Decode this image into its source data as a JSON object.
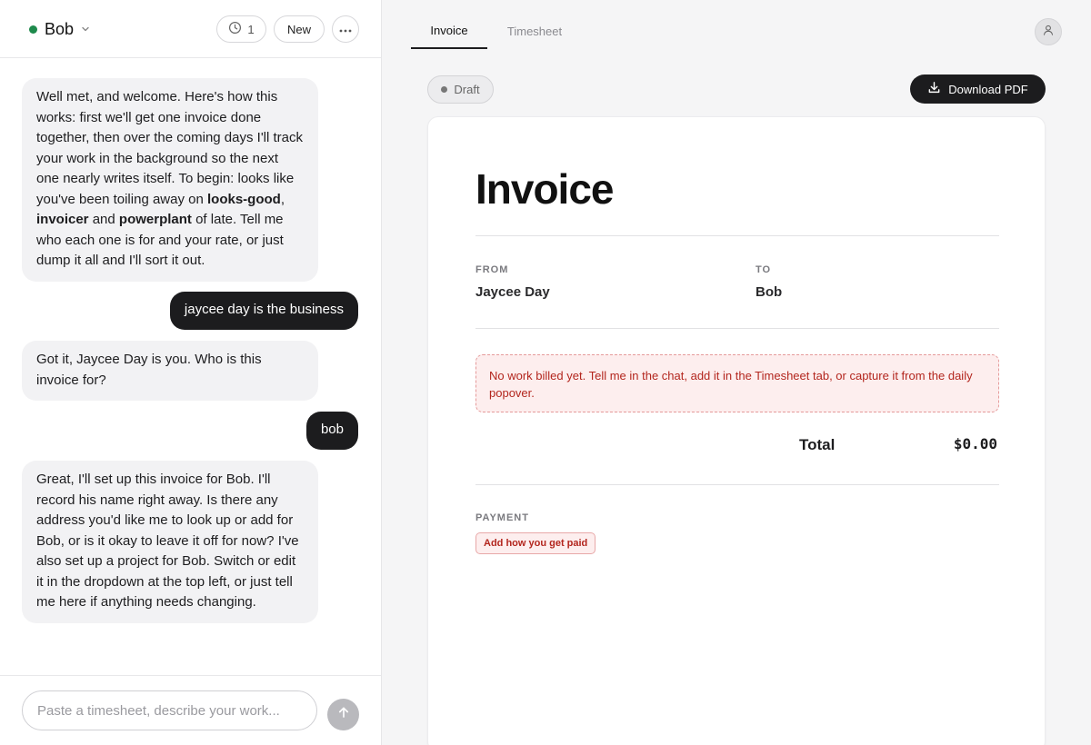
{
  "header": {
    "project_name": "Bob",
    "history_count": "1",
    "new_label": "New",
    "status_color": "#1e8a4c"
  },
  "chat": {
    "messages": [
      {
        "role": "assistant",
        "parts": [
          {
            "text": "Well met, and welcome. Here's how this works: first we'll get one invoice done together, then over the coming days I'll track your work in the background so the next one nearly writes itself. To begin: looks like you've been toiling away on "
          },
          {
            "text": "looks-good",
            "bold": true
          },
          {
            "text": ", "
          },
          {
            "text": "invoicer",
            "bold": true
          },
          {
            "text": " and "
          },
          {
            "text": "powerplant",
            "bold": true
          },
          {
            "text": " of late. Tell me who each one is for and your rate, or just dump it all and I'll sort it out."
          }
        ]
      },
      {
        "role": "user",
        "text": "jaycee day is the business"
      },
      {
        "role": "assistant",
        "text": "Got it, Jaycee Day is you. Who is this invoice for?"
      },
      {
        "role": "user",
        "text": "bob"
      },
      {
        "role": "assistant",
        "text": "Great, I'll set up this invoice for Bob. I'll record his name right away. Is there any address you'd like me to look up or add for Bob, or is it okay to leave it off for now? I've also set up a project for Bob. Switch or edit it in the dropdown at the top left, or just tell me here if anything needs changing."
      }
    ],
    "input_placeholder": "Paste a timesheet, describe your work..."
  },
  "tabs": {
    "invoice": "Invoice",
    "timesheet": "Timesheet",
    "active": "invoice"
  },
  "toolbar": {
    "status": "Draft",
    "download_label": "Download PDF"
  },
  "invoice": {
    "title": "Invoice",
    "from_label": "FROM",
    "from_value": "Jaycee Day",
    "to_label": "TO",
    "to_value": "Bob",
    "warning": "No work billed yet. Tell me in the chat, add it in the Timesheet tab, or capture it from the daily popover.",
    "total_label": "Total",
    "total_value": "$0.00",
    "payment_label": "PAYMENT",
    "payment_button": "Add how you get paid"
  },
  "colors": {
    "accent_dark": "#1c1c1e",
    "warning_text": "#b3261e",
    "warning_bg": "#fdeeee"
  }
}
